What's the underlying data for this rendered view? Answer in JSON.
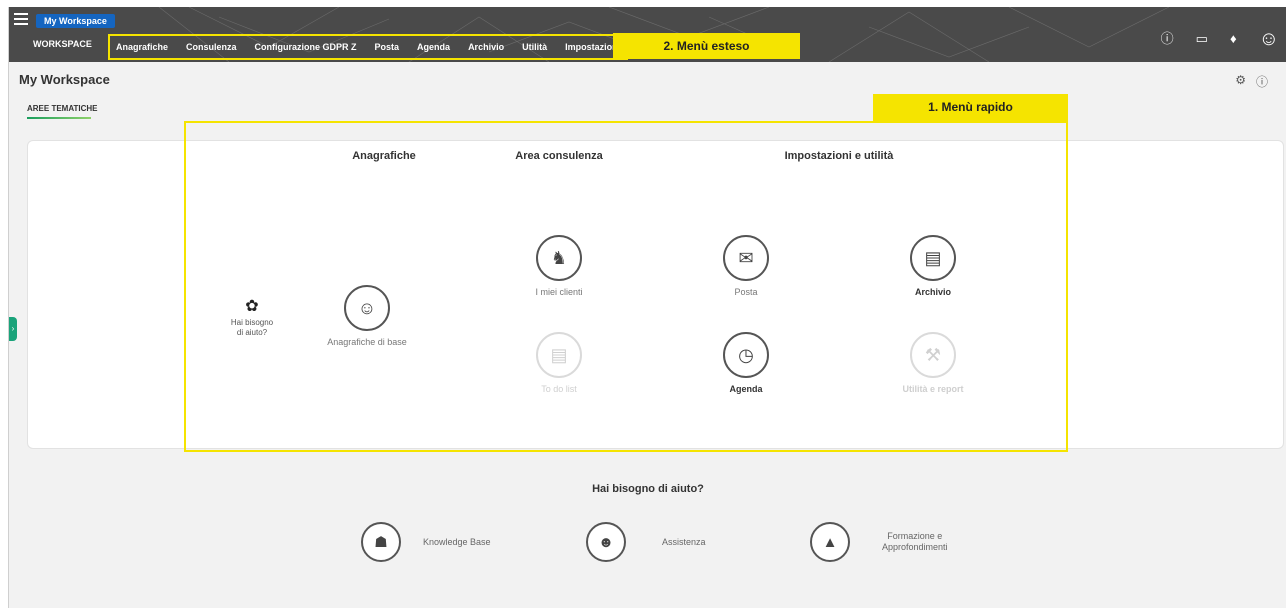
{
  "topbar": {
    "workspace_pill": "My Workspace",
    "workspace_label": "WORKSPACE",
    "menu": [
      "Anagrafiche",
      "Consulenza",
      "Configurazione GDPR Z",
      "Posta",
      "Agenda",
      "Archivio",
      "Utilità",
      "Impostazioni"
    ],
    "menu_callout": "2. Menù esteso",
    "icons": [
      "help-icon",
      "monitor-icon",
      "bell-icon",
      "user-icon"
    ]
  },
  "page": {
    "title": "My Workspace",
    "tab": "AREE TEMATICHE"
  },
  "quick_menu": {
    "callout": "1. Menù rapido",
    "columns": {
      "anagrafiche": "Anagrafiche",
      "consulenza": "Area consulenza",
      "impostazioni": "Impostazioni e utilità"
    },
    "help_mini": {
      "line1": "Hai bisogno",
      "line2": "di aiuto?"
    },
    "items": {
      "anagrafiche_base": {
        "label": "Anagrafiche di base",
        "icon": "user-circle-icon"
      },
      "miei_clienti": {
        "label": "I miei clienti",
        "icon": "clients-icon"
      },
      "to_do": {
        "label": "To do list",
        "icon": "clipboard-icon"
      },
      "posta": {
        "label": "Posta",
        "icon": "mail-icon"
      },
      "agenda": {
        "label": "Agenda",
        "icon": "calendar-icon"
      },
      "archivio": {
        "label": "Archivio",
        "icon": "archive-icon"
      },
      "utilita": {
        "label": "Utilità e report",
        "icon": "tools-icon"
      }
    }
  },
  "help": {
    "title": "Hai bisogno di aiuto?",
    "knowledge": "Knowledge Base",
    "assistenza": "Assistenza",
    "formazione_1": "Formazione e",
    "formazione_2": "Approfondimenti"
  },
  "colors": {
    "topbar": "#4a4a4a",
    "accent_yellow": "#f5e400",
    "pill_blue": "#1565c0",
    "tab_green": "#1a9e5e"
  }
}
